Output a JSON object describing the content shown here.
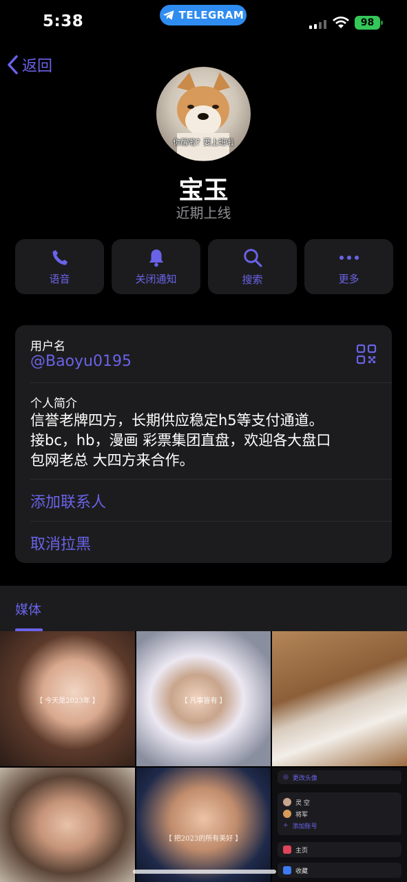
{
  "status_bar": {
    "time": "5:38",
    "pill_label": "TELEGRAM",
    "battery": "98"
  },
  "nav": {
    "back_label": "返回"
  },
  "profile": {
    "avatar_caption": "你醒啦？要上班啦",
    "name": "宝玉",
    "last_seen": "近期上线"
  },
  "actions": [
    {
      "label": "语音",
      "icon": "phone-icon"
    },
    {
      "label": "关闭通知",
      "icon": "bell-icon"
    },
    {
      "label": "搜索",
      "icon": "search-icon"
    },
    {
      "label": "更多",
      "icon": "more-icon"
    }
  ],
  "info": {
    "username_label": "用户名",
    "username": "@Baoyu0195",
    "bio_label": "个人简介",
    "bio_line1": "信誉老牌四方，长期供应稳定h5等支付通道。",
    "bio_line2": "接bc，hb，漫画 彩票集团直盘，欢迎各大盘口",
    "bio_line3": "包网老总 大四方来合作。",
    "add_contact": "添加联系人",
    "unblock": "取消拉黑"
  },
  "media": {
    "title": "媒体",
    "captions": [
      "【 今天是2023年 】",
      "【 凡事皆有 】",
      "【 把2023的所有美好 】"
    ],
    "mini_menu": {
      "change_avatar": "更改头像",
      "account1": "灵 空",
      "account2": "将军",
      "add_account": "添加账号",
      "home": "主页",
      "saved": "收藏"
    }
  },
  "colors": {
    "accent": "#6a63e8",
    "background": "#000000",
    "card": "#1c1c1e",
    "secondary_text": "#8e8e93",
    "telegram_blue": "#2f8cf0",
    "battery_green": "#34c759"
  }
}
